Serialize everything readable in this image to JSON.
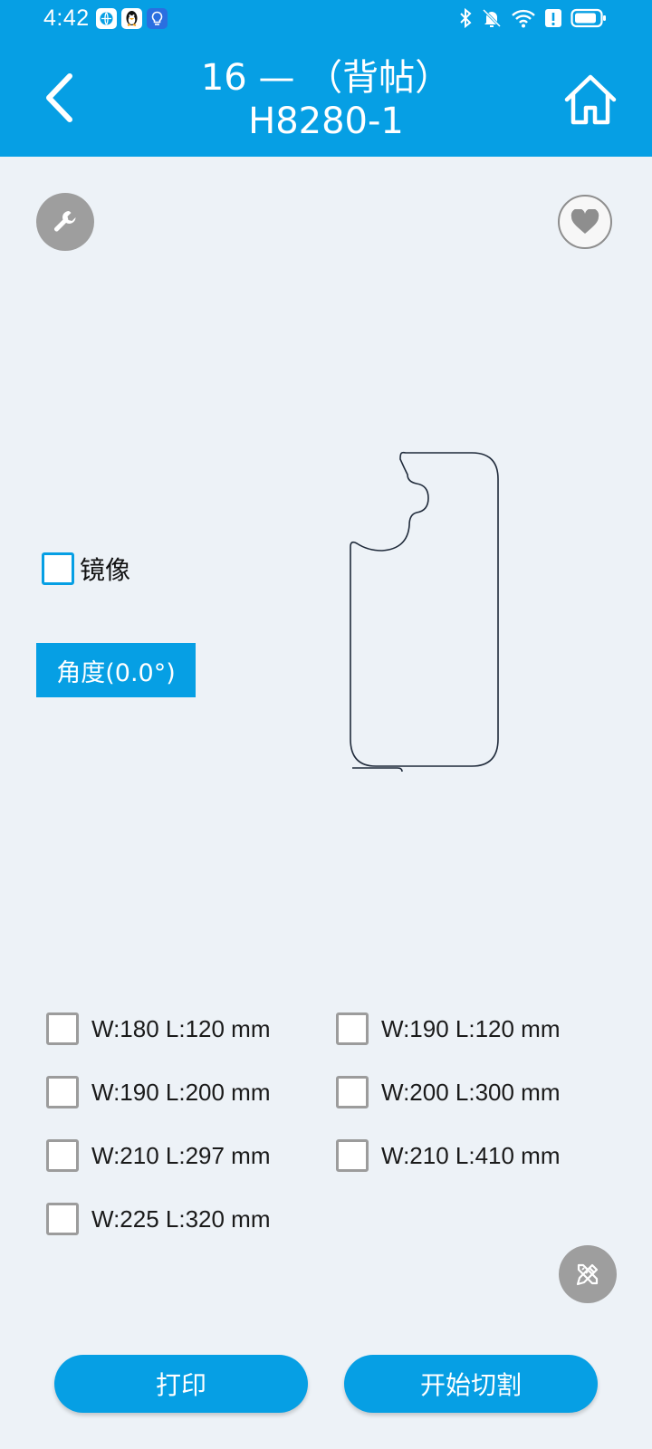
{
  "status_bar": {
    "time": "4:42",
    "notification_icons": [
      "browser-icon",
      "qq-penguin-icon",
      "bulb-app-icon"
    ],
    "system_icons": [
      "bluetooth-icon",
      "bell-muted-icon",
      "wifi-icon",
      "alert-icon",
      "battery-icon"
    ]
  },
  "header": {
    "title_line1": "16 — （背帖）",
    "title_line2": "H8280-1",
    "background": "#069fe4"
  },
  "controls": {
    "mirror_label": "镜像",
    "mirror_checked": false,
    "angle_label": "角度(0.0°)"
  },
  "size_options": [
    {
      "label": "W:180 L:120 mm",
      "checked": false
    },
    {
      "label": "W:190 L:120 mm",
      "checked": false
    },
    {
      "label": "W:190 L:200 mm",
      "checked": false
    },
    {
      "label": "W:200 L:300 mm",
      "checked": false
    },
    {
      "label": "W:210 L:297 mm",
      "checked": false
    },
    {
      "label": "W:210 L:410 mm",
      "checked": false
    },
    {
      "label": "W:225 L:320 mm",
      "checked": false
    }
  ],
  "buttons": {
    "print_label": "打印",
    "cut_label": "开始切割"
  },
  "colors": {
    "accent": "#069fe4",
    "background": "#edf2f7",
    "icon_button_gray": "#9e9e9e"
  }
}
